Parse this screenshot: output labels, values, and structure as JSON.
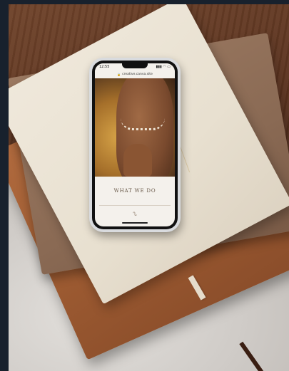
{
  "phone": {
    "status_time": "12:55",
    "status_icons": "▮▮▮ ◠ ▭",
    "url": "creative.canva.site",
    "section_title": "WHAT WE DO",
    "logo_glyph": "ᔐ"
  },
  "colors": {
    "wood": "#5c3420",
    "leather": "#a05d33",
    "cream_book": "#e8e0d0",
    "taupe_book": "#8a6a54",
    "stone": "#cfcbc7",
    "phone_frame": "#d9dbde",
    "screen_bg": "#f4f1ec"
  }
}
